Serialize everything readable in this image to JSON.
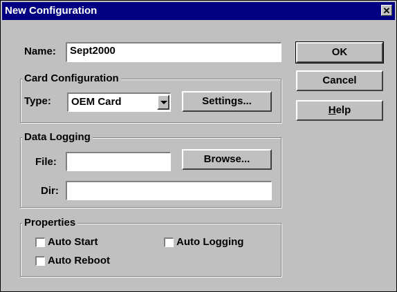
{
  "window": {
    "title": "New Configuration",
    "close_glyph": "✕"
  },
  "name": {
    "label": "Name:",
    "value": "Sept2000"
  },
  "buttons": {
    "ok": "OK",
    "cancel": "Cancel",
    "help_first": "H",
    "help_rest": "elp"
  },
  "card_configuration": {
    "title": "Card Configuration",
    "type_label": "Type:",
    "type_value": "OEM Card",
    "settings_button": "Settings..."
  },
  "data_logging": {
    "title": "Data Logging",
    "file_label": "File:",
    "file_value": "",
    "browse_button": "Browse...",
    "dir_label": "Dir:",
    "dir_value": ""
  },
  "properties": {
    "title": "Properties",
    "auto_start": "Auto Start",
    "auto_logging": "Auto Logging",
    "auto_reboot": "Auto Reboot"
  }
}
